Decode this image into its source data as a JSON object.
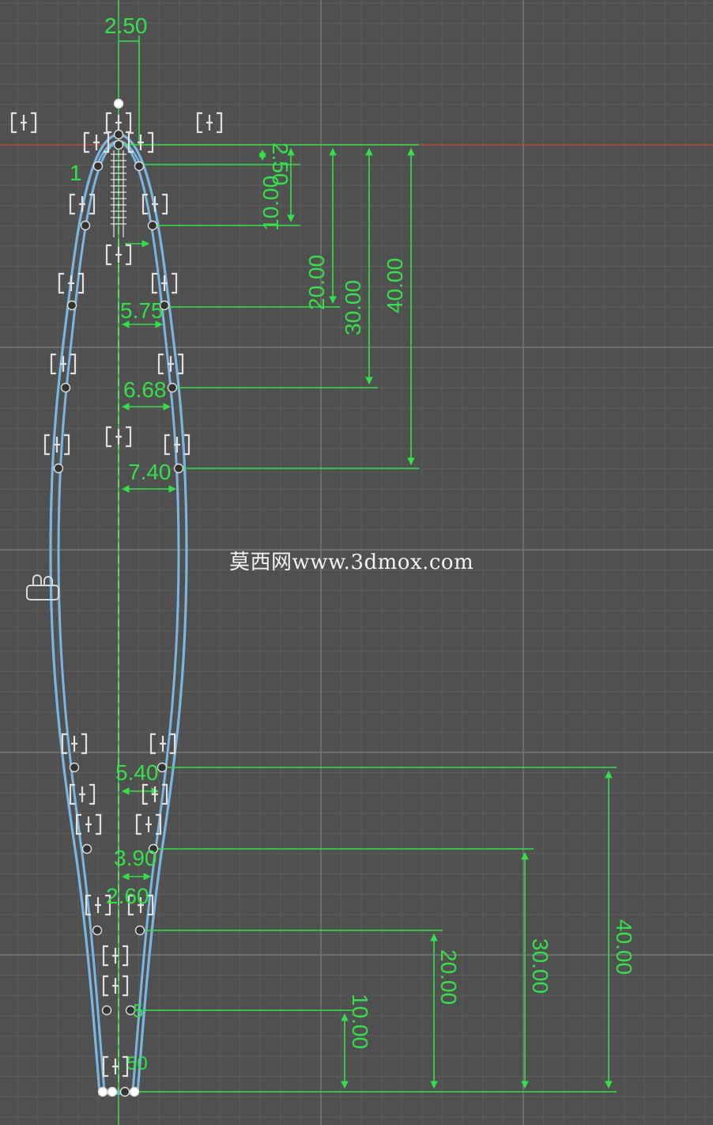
{
  "canvas": {
    "background": "#505050",
    "grid_minor_color": "#5c5c5c",
    "grid_major_color": "#777777",
    "profile_color": "#7ab6e0",
    "dimension_color": "#33e04a",
    "axis_color": "#c24a3a"
  },
  "watermark": "莫西网www.3dmox.com",
  "dimensions": {
    "top_tip_width": "2.50",
    "top_offset_small": "2.50",
    "top_offset_10": "10.00",
    "top_offset_20": "20.00",
    "top_offset_30": "30.00",
    "top_offset_40": "40.00",
    "width_at_20": "5.75",
    "width_at_30": "6.68",
    "width_at_40": "7.40",
    "side_label_top": "1",
    "bottom_width_40": "5.40",
    "bottom_width_30": "3.90",
    "bottom_width_20": "2.60",
    "bottom_width_10": "5",
    "bottom_width_0": "50",
    "bottom_offset_10": "10.00",
    "bottom_offset_20": "20.00",
    "bottom_offset_30": "30.00",
    "bottom_offset_40": "40.00"
  },
  "icons": [
    "constraint-icon",
    "construction-line-icon",
    "control-point-icon",
    "arrowhead-icon"
  ]
}
